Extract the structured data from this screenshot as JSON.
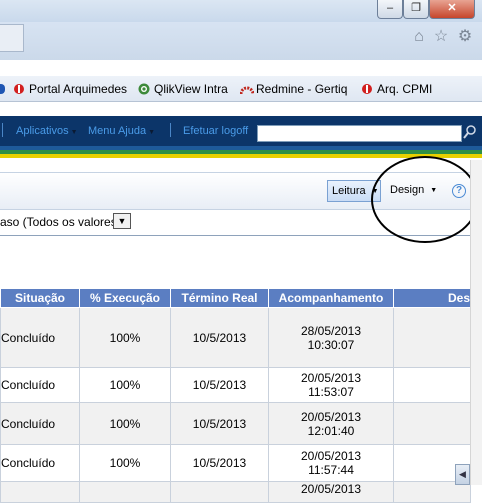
{
  "window": {
    "minimize_label": "–",
    "maximize_label": "❐",
    "close_label": "✕"
  },
  "browser_icons": {
    "home": "⌂",
    "favorites": "☆",
    "tools": "⚙"
  },
  "favorites_bar": {
    "items": [
      {
        "label": "Portal Arquimedes",
        "icon": "ie-shield-icon"
      },
      {
        "label": "QlikView Intra",
        "icon": "qlikview-icon"
      },
      {
        "label": "Redmine - Gertiq",
        "icon": "redmine-icon"
      },
      {
        "label": "Arq. CPMI",
        "icon": "ie-shield-icon"
      }
    ]
  },
  "app_nav": {
    "aplicativos": "Aplicativos",
    "menu_ajuda": "Menu Ajuda",
    "logoff": "Efetuar logoff",
    "search_value": ""
  },
  "toolbar": {
    "leitura": "Leitura",
    "design": "Design",
    "help": "?"
  },
  "filter": {
    "label": "aso (Todos os valores)",
    "dropdown_glyph": "▼"
  },
  "table": {
    "headers": [
      "Situação",
      "% Execução",
      "Término Real",
      "Acompanhamento",
      "Des"
    ],
    "rows": [
      {
        "situacao": "Concluído",
        "execucao": "100%",
        "termino": "10/5/2013",
        "acomp_date": "28/05/2013",
        "acomp_time": "10:30:07"
      },
      {
        "situacao": "Concluído",
        "execucao": "100%",
        "termino": "10/5/2013",
        "acomp_date": "20/05/2013",
        "acomp_time": "11:53:07"
      },
      {
        "situacao": "Concluído",
        "execucao": "100%",
        "termino": "10/5/2013",
        "acomp_date": "20/05/2013",
        "acomp_time": "12:01:40"
      },
      {
        "situacao": "Concluído",
        "execucao": "100%",
        "termino": "10/5/2013",
        "acomp_date": "20/05/2013",
        "acomp_time": "11:57:44"
      },
      {
        "situacao": "",
        "execucao": "",
        "termino": "",
        "acomp_date": "20/05/2013",
        "acomp_time": ""
      }
    ]
  },
  "scroll_left_glyph": "◀",
  "colors": {
    "nav_bg": "#0c3569",
    "nav_link": "#4a9be8",
    "header_bg": "#5b7ec2",
    "stripe_green": "#2f8f45",
    "stripe_yellow": "#e8d000"
  }
}
